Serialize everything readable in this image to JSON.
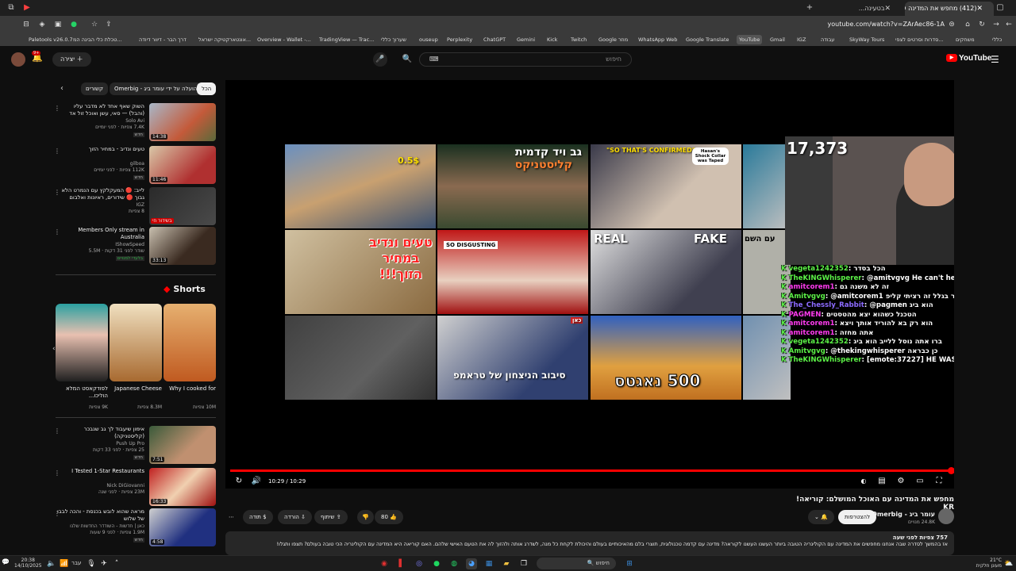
{
  "browser": {
    "tabs": [
      {
        "label": "(412) מחפש את המדינה עם הא...",
        "active": true
      },
      {
        "label": "בטעינה...",
        "active": false
      }
    ],
    "url": "youtube.com/watch?v=ZArAec86-1A",
    "bookmarks": [
      "Paletools v26.0.7",
      "טכלת כלי הבינה המ...",
      "דרך הבר - דיוור דיודה",
      "אונטארקטיקה ישראל...",
      "Overview - Wallet -...",
      "TradingView — Trac...",
      "שערוך כללי",
      "ouseup",
      "Perplexity",
      "ChatGPT",
      "Gemini",
      "Kick",
      "Twitch",
      "Google מוזר",
      "WhatsApp Web",
      "Google Translate",
      "YouTube",
      "Gmail",
      "IGZ",
      "עבודה",
      "SkyWay Tours",
      "סדרות וסרטים לצפי...",
      "משחקים",
      "כללי"
    ]
  },
  "youtube": {
    "logo": "YouTube",
    "search_placeholder": "חיפוש",
    "create_label": "יצירה",
    "notif_count": "9+"
  },
  "sidebar": {
    "chips": [
      "הכל",
      "הועלה על ידי עומר ביג - Omerbig",
      "קשורים"
    ],
    "recs": [
      {
        "title": "השוק שאף אחד לא מדבר עליו (והבל) — סאי, עשן ואוכל זול אד",
        "channel": "Solo Avi",
        "meta": "7.4K צפיות · לפני יומיים",
        "duration": "14:38",
        "badge": "חדש"
      },
      {
        "title": "טעים ונדיב - במחיר הזוך",
        "channel": "gilboa",
        "meta": "112K צפיות · לפני יומיים",
        "duration": "11:46",
        "badge": "חדש"
      },
      {
        "title": "לייב: 🔴 המעקלקץ עם הנמרט הלא גבוך 🔴 שידורים, ראיונות ואלבום",
        "channel": "IGZ",
        "meta": "8 צפיות",
        "duration": "בשידור חי",
        "badge": ""
      },
      {
        "title": "Members Only stream in Australia",
        "channel": "IShowSpeed",
        "meta": "שודר לפני 31 דקות · 5.5M",
        "duration": "33:13",
        "badge": "בלעדי למנויים"
      },
      {
        "title": "אימון שיעבוד לך גב שנבכר (קליסטניקה)",
        "channel": "Push Up Pro",
        "meta": "25 צפיות · לפני 33 דקות",
        "duration": "7:51",
        "badge": "חדש"
      },
      {
        "title": "I Tested 1-Star Restaurants",
        "channel": "Nick DiGiovanni",
        "meta": "23M צפיות · לפני שנה",
        "duration": "16:33",
        "badge": ""
      },
      {
        "title": "מראה שהוא לובש בכנסת - והכה לבבו של שלוש",
        "channel": "כאן | חדשות - השודדר החדשות שלנו",
        "meta": "1.9M צפיות · לפני 9 שעות",
        "duration": "4:58",
        "badge": "חדש"
      }
    ],
    "shorts_heading": "Shorts",
    "shorts": [
      {
        "title": "Why I cooked for",
        "views": "10M צפיות"
      },
      {
        "title": "Japanese Cheese",
        "views": "8.3M צפיות"
      },
      {
        "title": "לפודקאסט המלא הוליכו...",
        "views": "9K צפיות"
      }
    ]
  },
  "player": {
    "time": "10:29 / 10:29",
    "progress_fraction": 1.0,
    "grid_texts": {
      "t1_badge": "0.5$",
      "t2_title": "גב ויד קדמית",
      "t2_sub": "קליסטניקס",
      "t3_caption": "\"SO THAT'S CONFIRMED\"",
      "t3_bubble": "Hasan's Shock Collar was Taped",
      "t4_title": "טעים ונדיב במחיר הזוך!!!",
      "t5_title": "SO DISGUSTING",
      "t6_real": "REAL",
      "t6_fake": "FAKE",
      "t8_title": "סיבוב הניצחון של טראמפ",
      "t8_logo": "כאן",
      "t9_title": "500 נאגטס",
      "t4b_title": "עם השם"
    },
    "viewer_count": "17,373",
    "chat": [
      {
        "user": "vegeta1242352",
        "msg": "הכל בסדר"
      },
      {
        "user": "TheKINGWhisperer",
        "msg": "@amitvgvg He can't he is just"
      },
      {
        "user": "amitcorem1",
        "msg": "זה לא משנה גם"
      },
      {
        "user": "Amitvgvg",
        "msg": "@amitcorem1 מה הוא אומר בגלל זה רציתי קליפ"
      },
      {
        "user": "The_Chessly_Rabbit",
        "msg": "@pagmen הוא ביג"
      },
      {
        "user": "PAGMEN",
        "msg": "הטכנל כשהוא יצא מהטסטים"
      },
      {
        "user": "amitcorem1",
        "msg": "הוא רק בא להוריד אותך ויצא"
      },
      {
        "user": "amitcorem1",
        "msg": "אתה מחזה"
      },
      {
        "user": "vegeta1242352",
        "msg": "ברו אתה נוסל ללייב הוא ביג"
      },
      {
        "user": "Amitvgvg",
        "msg": "@thekingwhisperer כן כבראה"
      },
      {
        "user": "TheKINGWhisperer",
        "msg": "[emote:37227] HE WAS JUS"
      }
    ]
  },
  "video": {
    "title": "מחפש את המדינה עם האוכל המושלם: קוריאה! KR",
    "channel": "עומר ביג - Omerbig",
    "subs": "24.8K מנויים",
    "subscribe_label": "להצטרפות",
    "likes": "80",
    "share_label": "שיתוף",
    "download_label": "הורדה",
    "thanks_label": "תודה",
    "desc_line1": "757 צפיות  לפני שעה",
    "desc_line2": "אז בהמשך לסדרה שבה אנחנו מחפשים את המדינה עם הקולינריה הטובה ביותר העשנו העשנו לקוראה? מדינה עם קדמה טכנולוגית, תוצרי בלם מהאיכותיים בעולם והיכולת לקחת כל מנה, לשדרג אותה ולהזוך לה את הטעם האישי שלהם. האם קוריאה היא המדינה עם הקולינריה הכי טובה בעולם? תצפו ותגלו!"
  },
  "taskbar": {
    "time": "20:38",
    "date": "14/10/2025",
    "lang": "עבר",
    "search_label": "חיפוש",
    "weather_temp": "21°C",
    "weather_text": "מעונן חלקית"
  },
  "colors": {
    "accent": "#ff0000",
    "chat_green": "#5cf247"
  }
}
